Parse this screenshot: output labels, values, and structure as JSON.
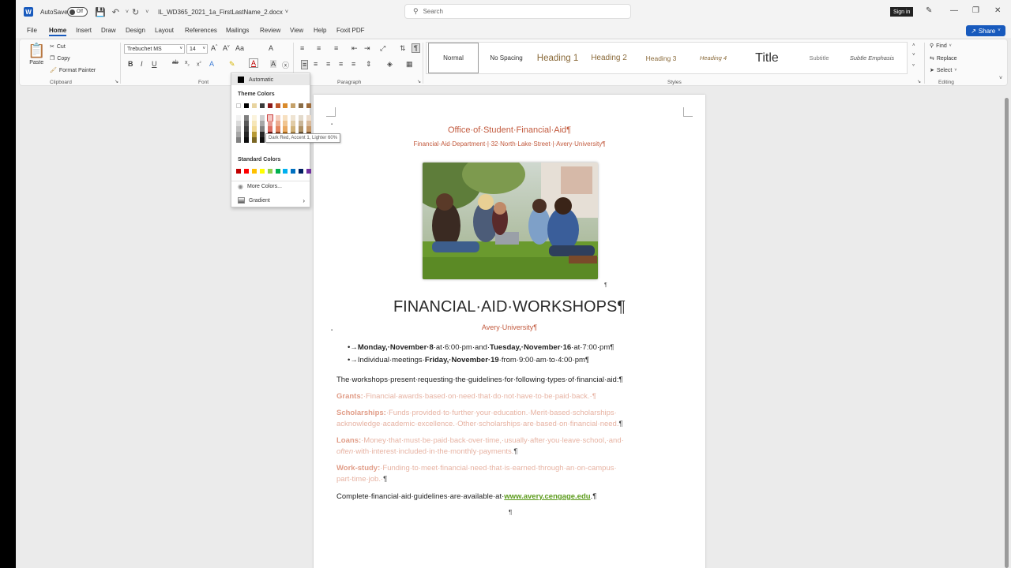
{
  "titlebar": {
    "app_logo": "W",
    "autosave_label": "AutoSave",
    "autosave_state": "Off",
    "filename": "IL_WD365_2021_1a_FirstLastName_2.docx",
    "search_placeholder": "Search",
    "signin_label": "Sign in"
  },
  "menu": {
    "tabs": [
      "File",
      "Home",
      "Insert",
      "Draw",
      "Design",
      "Layout",
      "References",
      "Mailings",
      "Review",
      "View",
      "Help",
      "Foxit PDF"
    ],
    "active_tab": "Home",
    "share_label": "Share"
  },
  "ribbon": {
    "clipboard": {
      "paste": "Paste",
      "cut": "Cut",
      "copy": "Copy",
      "format_painter": "Format Painter",
      "label": "Clipboard"
    },
    "font": {
      "name": "Trebuchet MS",
      "size": "14",
      "label": "Font"
    },
    "paragraph": {
      "label": "Paragraph"
    },
    "styles": {
      "label": "Styles",
      "items": [
        "Normal",
        "No Spacing",
        "Heading 1",
        "Heading 2",
        "Heading 3",
        "Heading 4",
        "Title",
        "Subtitle",
        "Subtle Emphasis"
      ],
      "selected": "Normal"
    },
    "editing": {
      "find": "Find",
      "replace": "Replace",
      "select": "Select",
      "label": "Editing"
    }
  },
  "color_dropdown": {
    "automatic": "Automatic",
    "theme_heading": "Theme Colors",
    "standard_heading": "Standard Colors",
    "more_colors": "More Colors...",
    "gradient": "Gradient",
    "tooltip": "Dark Red, Accent 1, Lighter 60%",
    "theme_top": [
      "#ffffff",
      "#000000",
      "#e8d4a0",
      "#3a3a3a",
      "#8b1a1a",
      "#c0562b",
      "#d98a2b",
      "#c4a16a",
      "#8a6d48",
      "#9e6b3a"
    ],
    "theme_shades": [
      [
        "#f2f2f2",
        "#7f7f7f",
        "#fbf3dc",
        "#d0d0d0",
        "#f4c7c3",
        "#f5d0bf",
        "#f7e0c0",
        "#efe4d2",
        "#e3dacb",
        "#ecdccb"
      ],
      [
        "#d9d9d9",
        "#595959",
        "#f6e6b8",
        "#a6a6a6",
        "#e79a92",
        "#ecaa8f",
        "#f0c490",
        "#e0cba5",
        "#c9b597",
        "#d9b998"
      ],
      [
        "#bfbfbf",
        "#3f3f3f",
        "#f1d995",
        "#7f7f7f",
        "#db6c61",
        "#e3845f",
        "#e9a860",
        "#d1b278",
        "#ae9063",
        "#c59665"
      ],
      [
        "#a6a6a6",
        "#262626",
        "#b89a35",
        "#262626",
        "#6a1313",
        "#91401f",
        "#a66718",
        "#9a7842",
        "#675136",
        "#76502b"
      ],
      [
        "#808080",
        "#0d0d0d",
        "#7a6623",
        "#0d0d0d",
        "#460d0d",
        "#602b14",
        "#6e4510",
        "#66502c",
        "#443624",
        "#4f351d"
      ]
    ],
    "standard": [
      "#c00000",
      "#ff0000",
      "#ffc000",
      "#ffff00",
      "#92d050",
      "#00b050",
      "#00b0f0",
      "#0070c0",
      "#002060",
      "#7030a0"
    ]
  },
  "document": {
    "office": "Office·of·Student·Financial·Aid¶",
    "address": "Financial·Aid·Department·|·32·North·Lake·Street·|·Avery·University¶",
    "pilcrow": "¶",
    "title": "FINANCIAL·AID·WORKSHOPS¶",
    "university": "Avery·University¶",
    "bullet1": {
      "prefix": "•→",
      "day1": "Monday,·November·8",
      "mid": "·at·6:00·pm·and·",
      "day2": "Tuesday,·November·16",
      "end": "·at·7:00·pm¶"
    },
    "bullet2": {
      "prefix": "•→",
      "start": "Individual·meetings·",
      "day": "Friday,·November·19",
      "end": "·from·9:00·am·to·4:00·pm¶"
    },
    "intro": "The·workshops·present·requesting·the·guidelines·for·following·types·of·financial·aid:¶",
    "grants_term": "Grants:",
    "grants_text": "·Financial·awards·based·on·need·that·do·not·have·to·be·paid·back.·¶",
    "scholarships_term": "Scholarships:",
    "scholarships_line1": "·Funds·provided·to·further·your·education.·Merit-based·scholarships·",
    "scholarships_line2": "acknowledge·academic·excellence.·Other·scholarships·are·based·on·financial·need.",
    "loans_term": "Loans:",
    "loans_line1": "·Money·that·must·be·paid·back·over·time,·usually·after·you·leave·school,·and·",
    "loans_italic": "often",
    "loans_line2": "·with·interest·included·in·the·monthly·payments.",
    "workstudy_term": "Work-study:",
    "workstudy_line1": "·Funding·to·meet·financial·need·that·is·earned·through·an·on-campus·",
    "workstudy_line2": "part-time·job.·",
    "closing_text": "Complete·financial·aid·guidelines·are·available·at·",
    "link": "www.avery.cengage.edu",
    "closing_end": ".¶"
  }
}
